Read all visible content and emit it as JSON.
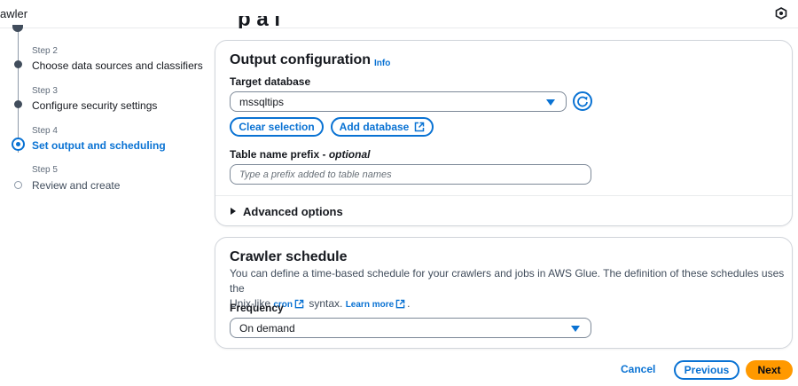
{
  "app": {
    "title": "awler"
  },
  "page": {
    "heading_fragment": "p  a       i"
  },
  "steps": [
    {
      "label": "Step 2",
      "title": "Choose data sources and classifiers",
      "state": "done"
    },
    {
      "label": "Step 3",
      "title": "Configure security settings",
      "state": "done"
    },
    {
      "label": "Step 4",
      "title": "Set output and scheduling",
      "state": "current"
    },
    {
      "label": "Step 5",
      "title": "Review and create",
      "state": "pending"
    }
  ],
  "output": {
    "title": "Output configuration",
    "info": "Info",
    "target_db_label": "Target database",
    "target_db_value": "mssqltips",
    "clear_selection": "Clear selection",
    "add_database": "Add database",
    "prefix_label": "Table name prefix - ",
    "prefix_optional": "optional",
    "prefix_placeholder": "Type a prefix added to table names",
    "advanced": "Advanced options"
  },
  "schedule": {
    "title": "Crawler schedule",
    "desc_line1": "You can define a time-based schedule for your crawlers and jobs in AWS Glue. The definition of these schedules uses the",
    "desc_line2_pre": "Unix-like ",
    "cron_link": "cron",
    "desc_line2_mid": " syntax. ",
    "learn_more": "Learn more",
    "desc_line2_end": ".",
    "frequency_label": "Frequency",
    "frequency_value": "On demand"
  },
  "footer": {
    "cancel": "Cancel",
    "previous": "Previous",
    "next": "Next"
  },
  "colors": {
    "accent": "#0972d3",
    "primary": "#ff9900"
  }
}
